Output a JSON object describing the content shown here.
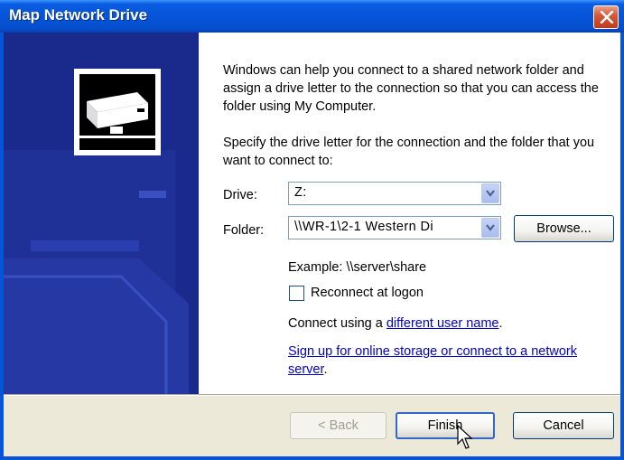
{
  "window": {
    "title": "Map Network Drive"
  },
  "content": {
    "intro": "Windows can help you connect to a shared network folder and assign a drive letter to the connection so that you can access the folder using My Computer.",
    "instruction": "Specify the drive letter for the connection and the folder that you want to connect to:",
    "drive_label": "Drive:",
    "drive_value": "Z:",
    "folder_label": "Folder:",
    "folder_value": "\\\\WR-1\\2-1 Western Di",
    "browse_label": "Browse...",
    "example": "Example: \\\\server\\share",
    "reconnect_label": "Reconnect at logon",
    "reconnect_checked": false,
    "connect_prefix": "Connect using a ",
    "connect_link": "different user name",
    "connect_suffix": ".",
    "signup_link": "Sign up for online storage or connect to a network server",
    "signup_suffix": "."
  },
  "footer": {
    "back_label": "< Back",
    "finish_label": "Finish",
    "cancel_label": "Cancel"
  },
  "colors": {
    "titlebar": "#0654d8",
    "panel": "#1a2a8c",
    "link": "#0000cc",
    "close": "#c2391a"
  },
  "icons": [
    "network-drive-icon",
    "close-icon",
    "chevron-down-icon",
    "mouse-cursor-icon"
  ]
}
